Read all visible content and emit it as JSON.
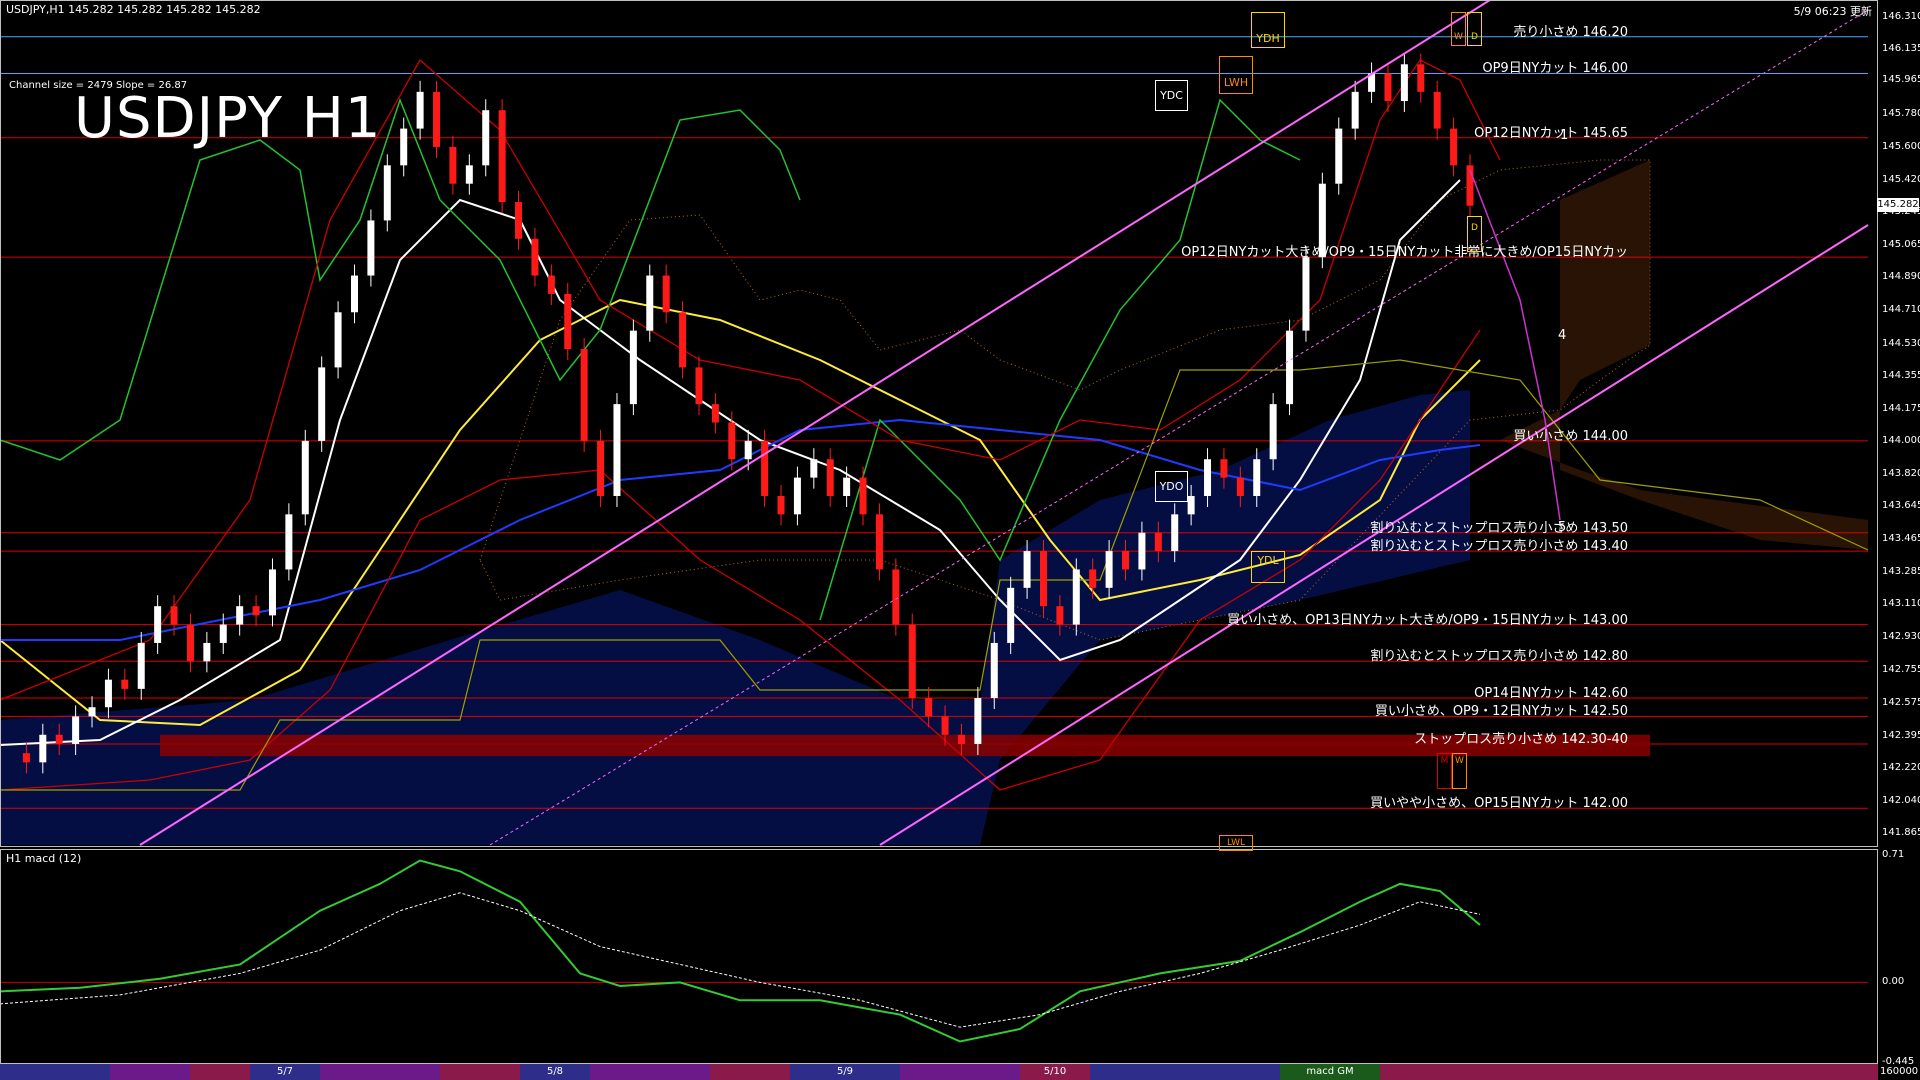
{
  "header": {
    "symbol_info": "USDJPY,H1  145.282 145.282 145.282 145.282",
    "updated": "5/9 06:23 更新",
    "channel_info": "Channel size = 2479 Slope = 26.87",
    "title": "USDJPY H1",
    "macd_label": "H1  macd (12)"
  },
  "price_axis": {
    "range": [
      141.8,
      146.4
    ],
    "ticks": [
      "146.310",
      "146.135",
      "145.965",
      "145.780",
      "145.600",
      "145.420",
      "145.245",
      "145.065",
      "144.890",
      "144.710",
      "144.530",
      "144.355",
      "144.175",
      "144.000",
      "143.820",
      "143.645",
      "143.465",
      "143.285",
      "143.110",
      "142.930",
      "142.755",
      "142.575",
      "142.395",
      "142.220",
      "142.040",
      "141.865"
    ],
    "current_price": "145.282"
  },
  "macd_axis": {
    "ticks": [
      "0.71",
      "0.00",
      "-0.445"
    ]
  },
  "levels": [
    {
      "price": 146.2,
      "label": "売り小さめ 146.20",
      "color": "#4da6ff"
    },
    {
      "price": 146.0,
      "label": "OP9日NYカット 146.00",
      "color": "#4da6ff"
    },
    {
      "price": 145.65,
      "label": "OP12日NYカット 145.65",
      "color": "#e00000"
    },
    {
      "price": 145.0,
      "label": "OP12日NYカット大きめ/OP9・15日NYカット非常に大きめ/OP15日NYカッ",
      "color": "#e00000"
    },
    {
      "price": 144.0,
      "label": "買い小さめ 144.00",
      "color": "#e00000"
    },
    {
      "price": 143.5,
      "label": "割り込むとストップロス売り小さめ 143.50",
      "color": "#e00000"
    },
    {
      "price": 143.4,
      "label": "割り込むとストップロス売り小さめ 143.40",
      "color": "#e00000"
    },
    {
      "price": 143.0,
      "label": "買い小さめ、OP13日NYカット大きめ/OP9・15日NYカット 143.00",
      "color": "#e00000"
    },
    {
      "price": 142.8,
      "label": "割り込むとストップロス売り小さめ 142.80",
      "color": "#e00000"
    },
    {
      "price": 142.6,
      "label": "OP14日NYカット 142.60",
      "color": "#e00000"
    },
    {
      "price": 142.5,
      "label": "買い小さめ、OP9・12日NYカット 142.50",
      "color": "#e00000"
    },
    {
      "price": 142.35,
      "label": "ストップロス売り小さめ 142.30-40",
      "color": "#e00000"
    },
    {
      "price": 142.0,
      "label": "買いやや小さめ、OP15日NYカット 142.00",
      "color": "#e00000"
    }
  ],
  "tags": {
    "ydh": "YDH",
    "ydc": "YDC",
    "lwh": "LWH",
    "ydo": "YDO",
    "ydl": "YDL",
    "lwl": "LWL",
    "w": "W",
    "d": "D",
    "m": "M"
  },
  "wave_numbers": [
    "1",
    "4",
    "5"
  ],
  "time_axis": {
    "labels": [
      "5/7",
      "5/8",
      "5/9",
      "5/10"
    ],
    "tail_text": "macd GM",
    "end_label": "160000"
  },
  "chart_data": {
    "type": "line",
    "title": "USDJPY H1",
    "ylim": [
      141.8,
      146.4
    ],
    "series": [
      {
        "name": "USDJPY",
        "values": [
          142.3,
          142.25,
          142.4,
          142.35,
          142.5,
          142.55,
          142.7,
          142.65,
          142.9,
          143.1,
          143.0,
          142.8,
          142.9,
          143.0,
          143.1,
          143.05,
          143.3,
          143.6,
          144.0,
          144.4,
          144.7,
          144.9,
          145.2,
          145.5,
          145.7,
          145.9,
          145.6,
          145.4,
          145.5,
          145.8,
          145.3,
          145.1,
          144.9,
          144.8,
          144.5,
          144.0,
          143.7,
          144.2,
          144.6,
          144.9,
          144.7,
          144.4,
          144.2,
          144.1,
          143.9,
          144.0,
          143.7,
          143.6,
          143.8,
          143.9,
          143.7,
          143.8,
          143.6,
          143.3,
          143.0,
          142.6,
          142.5,
          142.4,
          142.35,
          142.6,
          142.9,
          143.2,
          143.4,
          143.1,
          143.0,
          143.3,
          143.2,
          143.4,
          143.3,
          143.5,
          143.4,
          143.6,
          143.7,
          143.9,
          143.8,
          143.7,
          143.9,
          144.2,
          144.6,
          145.0,
          145.4,
          145.7,
          145.9,
          146.0,
          145.85,
          146.05,
          145.9,
          145.7,
          145.5,
          145.28
        ]
      }
    ]
  }
}
